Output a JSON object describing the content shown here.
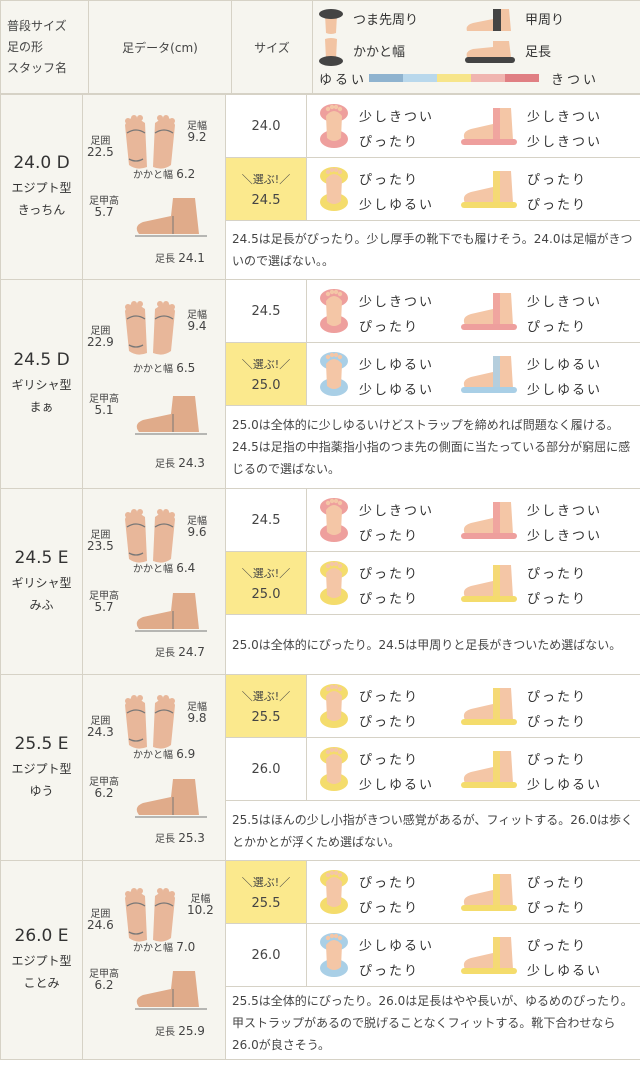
{
  "header": {
    "staff_col": [
      "普段サイズ",
      "足の形",
      "スタッフ名"
    ],
    "foot_col": "足データ(cm)",
    "size_col": "サイズ",
    "legend": {
      "toe": "つま先周り",
      "heel": "かかと幅",
      "instep": "甲周り",
      "length": "足長",
      "loose": "ゆるい",
      "tight": "きつい",
      "scale_colors": [
        "#8fb3cf",
        "#b9d8ec",
        "#f7e58a",
        "#f0b5b0",
        "#e07f83"
      ]
    }
  },
  "labels": {
    "girth": "足囲",
    "width": "足幅",
    "heel": "かかと幅",
    "instep_height": "足甲高",
    "length": "足長",
    "pick": "＼選ぶ!／"
  },
  "staff": [
    {
      "size": "24.0 D",
      "type": "エジプト型",
      "name": "きっちん",
      "girth": "22.5",
      "width": "9.2",
      "heel": "6.2",
      "instep": "5.7",
      "length": "24.1",
      "rows": [
        {
          "size": "24.0",
          "picked": false,
          "toe": "少しきつい",
          "heel": "ぴったり",
          "instep": "少しきつい",
          "length": "少しきつい",
          "toe_color": "#ee9f9d",
          "heel_color": "#f4dc6c",
          "instep_color": "#ee9f9d",
          "length_color": "#ee9f9d"
        },
        {
          "size": "24.5",
          "picked": true,
          "toe": "ぴったり",
          "heel": "少しゆるい",
          "instep": "ぴったり",
          "length": "ぴったり",
          "toe_color": "#f4dc6c",
          "heel_color": "#a9cfe6",
          "instep_color": "#f4dc6c",
          "length_color": "#f4dc6c"
        }
      ],
      "comment": "24.5は足長がぴったり。少し厚手の靴下でも履けそう。24.0は足幅がきついので選ばない。。"
    },
    {
      "size": "24.5 D",
      "type": "ギリシャ型",
      "name": "まぁ",
      "girth": "22.9",
      "width": "9.4",
      "heel": "6.5",
      "instep": "5.1",
      "length": "24.3",
      "rows": [
        {
          "size": "24.5",
          "picked": false,
          "toe": "少しきつい",
          "heel": "ぴったり",
          "instep": "少しきつい",
          "length": "ぴったり",
          "toe_color": "#ee9f9d",
          "heel_color": "#f4dc6c",
          "instep_color": "#ee9f9d",
          "length_color": "#f4dc6c"
        },
        {
          "size": "25.0",
          "picked": true,
          "toe": "少しゆるい",
          "heel": "少しゆるい",
          "instep": "少しゆるい",
          "length": "少しゆるい",
          "toe_color": "#a9cfe6",
          "heel_color": "#a9cfe6",
          "instep_color": "#a9cfe6",
          "length_color": "#a9cfe6"
        }
      ],
      "comment": "25.0は全体的に少しゆるいけどストラップを締めれば問題なく履ける。24.5は足指の中指薬指小指のつま先の側面に当たっている部分が窮屈に感じるので選ばない。"
    },
    {
      "size": "24.5 E",
      "type": "ギリシャ型",
      "name": "みふ",
      "girth": "23.5",
      "width": "9.6",
      "heel": "6.4",
      "instep": "5.7",
      "length": "24.7",
      "rows": [
        {
          "size": "24.5",
          "picked": false,
          "toe": "少しきつい",
          "heel": "ぴったり",
          "instep": "少しきつい",
          "length": "少しきつい",
          "toe_color": "#ee9f9d",
          "heel_color": "#f4dc6c",
          "instep_color": "#ee9f9d",
          "length_color": "#ee9f9d"
        },
        {
          "size": "25.0",
          "picked": true,
          "toe": "ぴったり",
          "heel": "ぴったり",
          "instep": "ぴったり",
          "length": "ぴったり",
          "toe_color": "#f4dc6c",
          "heel_color": "#f4dc6c",
          "instep_color": "#f4dc6c",
          "length_color": "#f4dc6c"
        }
      ],
      "comment": "25.0は全体的にぴったり。24.5は甲周りと足長がきついため選ばない。"
    },
    {
      "size": "25.5 E",
      "type": "エジプト型",
      "name": "ゆう",
      "girth": "24.3",
      "width": "9.8",
      "heel": "6.9",
      "instep": "6.2",
      "length": "25.3",
      "rows": [
        {
          "size": "25.5",
          "picked": true,
          "toe": "ぴったり",
          "heel": "ぴったり",
          "instep": "ぴったり",
          "length": "ぴったり",
          "toe_color": "#f4dc6c",
          "heel_color": "#f4dc6c",
          "instep_color": "#f4dc6c",
          "length_color": "#f4dc6c"
        },
        {
          "size": "26.0",
          "picked": false,
          "toe": "ぴったり",
          "heel": "少しゆるい",
          "instep": "ぴったり",
          "length": "少しゆるい",
          "toe_color": "#f4dc6c",
          "heel_color": "#a9cfe6",
          "instep_color": "#f4dc6c",
          "length_color": "#a9cfe6"
        }
      ],
      "comment": "25.5はほんの少し小指がきつい感覚があるが、フィットする。26.0は歩くとかかとが浮くため選ばない。"
    },
    {
      "size": "26.0 E",
      "type": "エジプト型",
      "name": "ことみ",
      "girth": "24.6",
      "width": "10.2",
      "heel": "7.0",
      "instep": "6.2",
      "length": "25.9",
      "rows": [
        {
          "size": "25.5",
          "picked": true,
          "toe": "ぴったり",
          "heel": "ぴったり",
          "instep": "ぴったり",
          "length": "ぴったり",
          "toe_color": "#f4dc6c",
          "heel_color": "#f4dc6c",
          "instep_color": "#f4dc6c",
          "length_color": "#f4dc6c"
        },
        {
          "size": "26.0",
          "picked": false,
          "toe": "少しゆるい",
          "heel": "ぴったり",
          "instep": "ぴったり",
          "length": "少しゆるい",
          "toe_color": "#a9cfe6",
          "heel_color": "#f4dc6c",
          "instep_color": "#f4dc6c",
          "length_color": "#a9cfe6"
        }
      ],
      "comment": "25.5は全体的にぴったり。26.0は足長はやや長いが、ゆるめのぴったり。甲ストラップがあるので脱げることなくフィットする。靴下合わせなら26.0が良さそう。"
    }
  ]
}
